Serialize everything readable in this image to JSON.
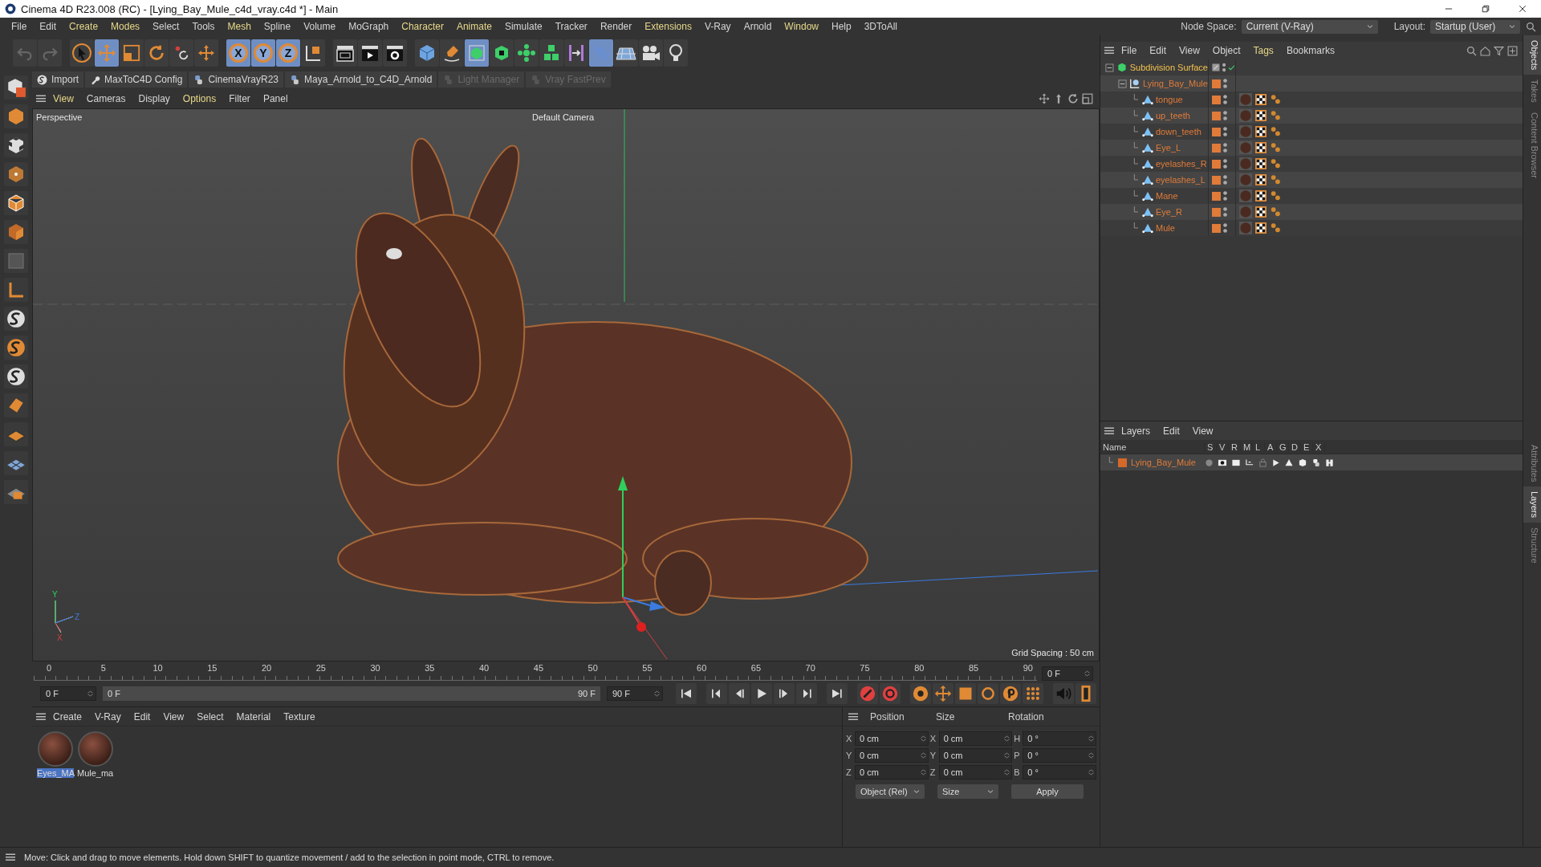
{
  "window": {
    "title": "Cinema 4D R23.008 (RC) - [Lying_Bay_Mule_c4d_vray.c4d *] - Main"
  },
  "menu": [
    {
      "label": "File",
      "highlighted": false
    },
    {
      "label": "Edit",
      "highlighted": false
    },
    {
      "label": "Create",
      "highlighted": true
    },
    {
      "label": "Modes",
      "highlighted": true
    },
    {
      "label": "Select",
      "highlighted": false
    },
    {
      "label": "Tools",
      "highlighted": false
    },
    {
      "label": "Mesh",
      "highlighted": true
    },
    {
      "label": "Spline",
      "highlighted": false
    },
    {
      "label": "Volume",
      "highlighted": false
    },
    {
      "label": "MoGraph",
      "highlighted": false
    },
    {
      "label": "Character",
      "highlighted": true
    },
    {
      "label": "Animate",
      "highlighted": true
    },
    {
      "label": "Simulate",
      "highlighted": false
    },
    {
      "label": "Tracker",
      "highlighted": false
    },
    {
      "label": "Render",
      "highlighted": false
    },
    {
      "label": "Extensions",
      "highlighted": true
    },
    {
      "label": "V-Ray",
      "highlighted": false
    },
    {
      "label": "Arnold",
      "highlighted": false
    },
    {
      "label": "Window",
      "highlighted": true
    },
    {
      "label": "Help",
      "highlighted": false
    },
    {
      "label": "3DToAll",
      "highlighted": false
    }
  ],
  "node_space": {
    "label": "Node Space:",
    "value": "Current (V-Ray)"
  },
  "layout": {
    "label": "Layout:",
    "value": "Startup (User)"
  },
  "toolbar": [
    {
      "kind": "undo",
      "selected": false
    },
    {
      "kind": "redo",
      "selected": false
    },
    {
      "kind": "sep"
    },
    {
      "kind": "cursor",
      "selected": false
    },
    {
      "kind": "move",
      "selected": true
    },
    {
      "kind": "scale",
      "selected": false
    },
    {
      "kind": "rotate",
      "selected": false
    },
    {
      "kind": "psr",
      "selected": false
    },
    {
      "kind": "add",
      "selected": false
    },
    {
      "kind": "sep"
    },
    {
      "kind": "axis",
      "label": "X",
      "selected": true
    },
    {
      "kind": "axis",
      "label": "Y",
      "selected": true
    },
    {
      "kind": "axis",
      "label": "Z",
      "selected": true
    },
    {
      "kind": "coords",
      "selected": false
    },
    {
      "kind": "sep"
    },
    {
      "kind": "clapper",
      "selected": false
    },
    {
      "kind": "render",
      "selected": false
    },
    {
      "kind": "render-settings",
      "selected": false
    },
    {
      "kind": "sep"
    },
    {
      "kind": "cube",
      "selected": false
    },
    {
      "kind": "pen",
      "selected": false
    },
    {
      "kind": "subdiv",
      "selected": true
    },
    {
      "kind": "extrude",
      "selected": false
    },
    {
      "kind": "cloner",
      "selected": false
    },
    {
      "kind": "cubes",
      "selected": false
    },
    {
      "kind": "symmetry",
      "selected": false
    },
    {
      "kind": "deformer",
      "selected": true
    },
    {
      "kind": "floor",
      "selected": false
    },
    {
      "kind": "camera",
      "selected": false
    },
    {
      "kind": "light",
      "selected": false
    }
  ],
  "plugins": [
    {
      "label": "Import",
      "disabled": false
    },
    {
      "label": "MaxToC4D Config",
      "disabled": false
    },
    {
      "label": "CinemaVrayR23",
      "disabled": false
    },
    {
      "label": "Maya_Arnold_to_C4D_Arnold",
      "disabled": false
    },
    {
      "label": "Light Manager",
      "disabled": true
    },
    {
      "label": "Vray FastPrev",
      "disabled": true
    }
  ],
  "left_tools": [
    {
      "kind": "make-editable"
    },
    {
      "kind": "model"
    },
    {
      "kind": "texture"
    },
    {
      "kind": "points"
    },
    {
      "kind": "edges"
    },
    {
      "kind": "polygons"
    },
    {
      "kind": "uv"
    },
    {
      "kind": "axis"
    },
    {
      "kind": "snap"
    },
    {
      "kind": "snap-orange"
    },
    {
      "kind": "snap"
    },
    {
      "kind": "magnet"
    },
    {
      "kind": "workplane"
    },
    {
      "kind": "grid"
    },
    {
      "kind": "lock"
    }
  ],
  "viewport": {
    "menu": [
      {
        "label": "View",
        "highlighted": true
      },
      {
        "label": "Cameras",
        "highlighted": false
      },
      {
        "label": "Display",
        "highlighted": false
      },
      {
        "label": "Options",
        "highlighted": true
      },
      {
        "label": "Filter",
        "highlighted": false
      },
      {
        "label": "Panel",
        "highlighted": false
      }
    ],
    "name": "Perspective",
    "camera": "Default Camera",
    "grid_spacing": "Grid Spacing : 50 cm",
    "axis_labels": [
      "Y",
      "Z",
      "X"
    ]
  },
  "timeline": {
    "ticks": [
      "0",
      "5",
      "10",
      "15",
      "20",
      "25",
      "30",
      "35",
      "40",
      "45",
      "50",
      "55",
      "60",
      "65",
      "70",
      "75",
      "80",
      "85",
      "90"
    ],
    "current": "0 F",
    "start": "0 F",
    "range_start": "0 F",
    "range_end": "90 F",
    "level": 1,
    "end": "90 F"
  },
  "playback": [
    {
      "kind": "first"
    },
    {
      "kind": "sep"
    },
    {
      "kind": "prev-key"
    },
    {
      "kind": "prev"
    },
    {
      "kind": "play"
    },
    {
      "kind": "next"
    },
    {
      "kind": "next-key"
    },
    {
      "kind": "sep"
    },
    {
      "kind": "last"
    },
    {
      "kind": "sep"
    },
    {
      "kind": "record"
    },
    {
      "kind": "autokey"
    },
    {
      "kind": "sep"
    },
    {
      "kind": "keyset"
    },
    {
      "kind": "key-move"
    },
    {
      "kind": "key-scale"
    },
    {
      "kind": "key-rotate"
    },
    {
      "kind": "key-param"
    },
    {
      "kind": "key-points"
    },
    {
      "kind": "sep"
    },
    {
      "kind": "sound"
    },
    {
      "kind": "film"
    }
  ],
  "materials": {
    "menu": [
      "Create",
      "V-Ray",
      "Edit",
      "View",
      "Select",
      "Material",
      "Texture"
    ],
    "items": [
      {
        "name": "Eyes_MA",
        "selected": true
      },
      {
        "name": "Mule_ma",
        "selected": false
      }
    ]
  },
  "coordinates": {
    "headers": [
      "Position",
      "Size",
      "Rotation"
    ],
    "rows": [
      [
        {
          "axis": "X",
          "value": "0 cm"
        },
        {
          "axis": "X",
          "value": "0 cm"
        },
        {
          "axis": "H",
          "value": "0 °"
        }
      ],
      [
        {
          "axis": "Y",
          "value": "0 cm"
        },
        {
          "axis": "Y",
          "value": "0 cm"
        },
        {
          "axis": "P",
          "value": "0 °"
        }
      ],
      [
        {
          "axis": "Z",
          "value": "0 cm"
        },
        {
          "axis": "Z",
          "value": "0 cm"
        },
        {
          "axis": "B",
          "value": "0 °"
        }
      ]
    ],
    "mode": "Object (Rel)",
    "size_mode": "Size",
    "apply": "Apply"
  },
  "objects": {
    "menu": [
      {
        "label": "File",
        "highlighted": false
      },
      {
        "label": "Edit",
        "highlighted": false
      },
      {
        "label": "View",
        "highlighted": false
      },
      {
        "label": "Object",
        "highlighted": false
      },
      {
        "label": "Tags",
        "highlighted": true
      },
      {
        "label": "Bookmarks",
        "highlighted": false
      }
    ],
    "tree": [
      {
        "name": "Subdivision Surface",
        "kind": "generator",
        "expanded": true,
        "children": [
          {
            "name": "Lying_Bay_Mule",
            "kind": "null",
            "expanded": true,
            "children": [
              {
                "name": "tongue",
                "kind": "mesh"
              },
              {
                "name": "up_teeth",
                "kind": "mesh"
              },
              {
                "name": "down_teeth",
                "kind": "mesh"
              },
              {
                "name": "Eye_L",
                "kind": "mesh"
              },
              {
                "name": "eyelashes_R",
                "kind": "mesh"
              },
              {
                "name": "eyelashes_L",
                "kind": "mesh"
              },
              {
                "name": "Mane",
                "kind": "mesh"
              },
              {
                "name": "Eye_R",
                "kind": "mesh"
              },
              {
                "name": "Mule",
                "kind": "mesh"
              }
            ]
          }
        ]
      }
    ]
  },
  "layers": {
    "menu": [
      "Layers",
      "Edit",
      "View"
    ],
    "columns": [
      "Name",
      "S",
      "V",
      "R",
      "M",
      "L",
      "A",
      "G",
      "D",
      "E",
      "X"
    ],
    "rows": [
      {
        "name": "Lying_Bay_Mule",
        "color": "#d4692a"
      }
    ]
  },
  "side_tabs": [
    "Objects",
    "Takes",
    "Content Browser"
  ],
  "side_tabs_lower": [
    "Attributes",
    "Layers",
    "Structure"
  ],
  "status_bar": "Move: Click and drag to move elements. Hold down SHIFT to quantize movement / add to the selection in point mode, CTRL to remove."
}
